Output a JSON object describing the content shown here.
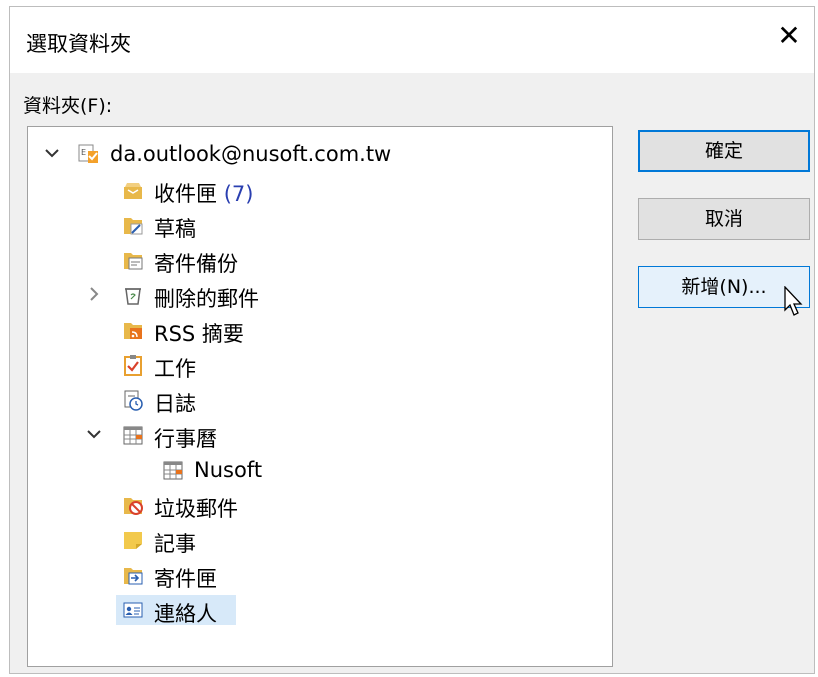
{
  "dialog": {
    "title": "選取資料夾",
    "close_glyph": "✕"
  },
  "folder_label": "資料夾(F):",
  "tree": {
    "account": "da.outlook@nusoft.com.tw",
    "items": [
      {
        "label": "收件匣",
        "count": "(7)",
        "icon": "inbox-icon"
      },
      {
        "label": "草稿",
        "icon": "drafts-icon"
      },
      {
        "label": "寄件備份",
        "icon": "sent-items-icon"
      },
      {
        "label": "刪除的郵件",
        "icon": "deleted-items-icon"
      },
      {
        "label": "RSS 摘要",
        "icon": "rss-icon"
      },
      {
        "label": "工作",
        "icon": "tasks-icon"
      },
      {
        "label": "日誌",
        "icon": "journal-icon"
      },
      {
        "label": "行事曆",
        "icon": "calendar-icon"
      },
      {
        "label": "Nusoft",
        "icon": "calendar-icon"
      },
      {
        "label": "垃圾郵件",
        "icon": "junk-icon"
      },
      {
        "label": "記事",
        "icon": "notes-icon"
      },
      {
        "label": "寄件匣",
        "icon": "outbox-icon"
      },
      {
        "label": "連絡人",
        "icon": "contacts-icon"
      }
    ]
  },
  "buttons": {
    "ok": "確定",
    "cancel": "取消",
    "new": "新增(N)..."
  },
  "colors": {
    "accent": "#0078d7",
    "selection": "#d7e9f9",
    "count": "#2a3fb0",
    "folder": "#e8b84a"
  }
}
